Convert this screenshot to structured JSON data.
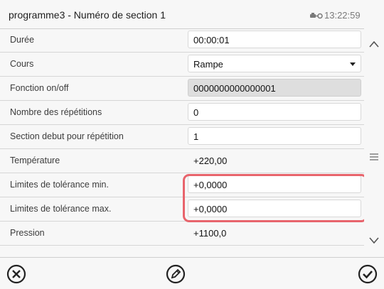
{
  "header": {
    "title": "programme3 - Numéro de section 1",
    "time": "13:22:59",
    "clock_icon": "clock-network-icon"
  },
  "rows": [
    {
      "label": "Durée",
      "value": "00:00:01",
      "type": "input"
    },
    {
      "label": "Cours",
      "value": "Rampe",
      "type": "select"
    },
    {
      "label": "Fonction on/off",
      "value": "0000000000000001",
      "type": "disabled"
    },
    {
      "label": "Nombre des répétitions",
      "value": "0",
      "type": "input"
    },
    {
      "label": "Section debut pour répétition",
      "value": "1",
      "type": "input"
    },
    {
      "label": "Température",
      "value": "+220,00",
      "type": "plain"
    },
    {
      "label": "Limites de tolérance min.",
      "value": "+0,0000",
      "type": "input"
    },
    {
      "label": "Limites de tolérance max.",
      "value": "+0,0000",
      "type": "input"
    },
    {
      "label": "Pression",
      "value": "+1100,0",
      "type": "plain"
    }
  ],
  "footer": {
    "cancel_icon": "cancel-icon",
    "edit_icon": "edit-pencil-icon",
    "confirm_icon": "checkmark-icon"
  },
  "scrollbar": {
    "up_icon": "chevron-up-icon",
    "menu_icon": "menu-icon",
    "down_icon": "chevron-down-icon"
  },
  "colors": {
    "highlight": "#e8646c",
    "disabled_field": "#dedede"
  }
}
